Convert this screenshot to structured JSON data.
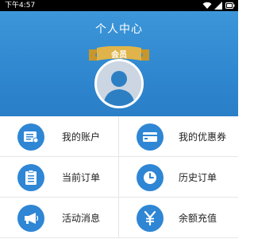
{
  "status_bar": {
    "time": "下午4:57"
  },
  "header": {
    "title": "个人中心",
    "badge": "会员"
  },
  "menu": [
    {
      "label": "我的账户",
      "icon": "account-card-icon"
    },
    {
      "label": "我的优惠券",
      "icon": "coupon-wallet-icon"
    },
    {
      "label": "当前订单",
      "icon": "clipboard-order-icon"
    },
    {
      "label": "历史订单",
      "icon": "clock-history-icon"
    },
    {
      "label": "活动消息",
      "icon": "megaphone-icon"
    },
    {
      "label": "余额充值",
      "icon": "yen-recharge-icon"
    }
  ],
  "colors": {
    "header_blue": "#3d96d9",
    "icon_blue": "#2e86d4",
    "ribbon_gold": "#e0b44a"
  }
}
